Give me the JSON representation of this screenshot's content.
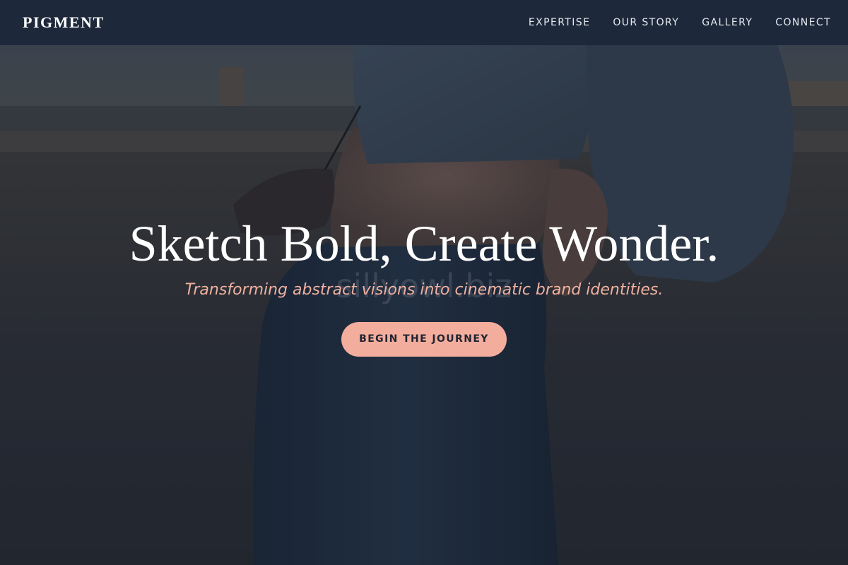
{
  "nav": {
    "logo": "PIGMENT",
    "links": [
      {
        "label": "EXPERTISE"
      },
      {
        "label": "OUR STORY"
      },
      {
        "label": "GALLERY"
      },
      {
        "label": "CONNECT"
      }
    ]
  },
  "hero": {
    "title": "Sketch Bold, Create Wonder.",
    "subtitle": "Transforming abstract visions into cinematic brand identities.",
    "cta_label": "BEGIN THE JOURNEY",
    "watermark": "sillyowl.biz"
  },
  "colors": {
    "navbar_bg": "#1b2638",
    "accent": "#f3ad9c",
    "subtitle": "#f0b1a0",
    "title": "#ffffff"
  }
}
